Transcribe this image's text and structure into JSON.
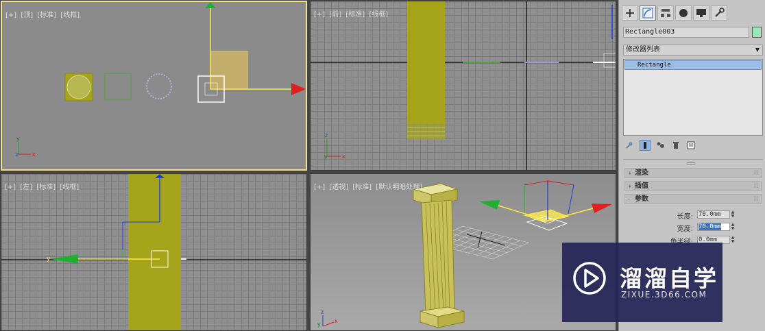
{
  "viewports": {
    "top": {
      "plus": "[+]",
      "view": "[顶]",
      "shading": "[标准]",
      "mode": "[线框]"
    },
    "front": {
      "plus": "[+]",
      "view": "[前]",
      "shading": "[标准]",
      "mode": "[线框]"
    },
    "left": {
      "plus": "[+]",
      "view": "[左]",
      "shading": "[标准]",
      "mode": "[线框]"
    },
    "perspective": {
      "plus": "[+]",
      "view": "[透视]",
      "shading": "[标准]",
      "mode": "[默认明暗处理]"
    }
  },
  "axes": {
    "x": "x",
    "y": "y",
    "z": "z"
  },
  "panel": {
    "tabs": [
      "create-icon",
      "modify-icon",
      "hierarchy-icon",
      "motion-icon",
      "display-icon",
      "utilities-icon"
    ],
    "active_tab": "modify-icon",
    "object_name": "Rectangle003",
    "object_color": "#9ae6b8",
    "modifier_list_label": "修改器列表",
    "modifier_stack": [
      "Rectangle"
    ],
    "rollouts": {
      "render": {
        "sign": "+",
        "label": "渲染"
      },
      "interp": {
        "sign": "+",
        "label": "插值"
      },
      "params": {
        "sign": "-",
        "label": "参数"
      }
    },
    "params": {
      "length": {
        "label": "长度:",
        "value": "70.0mm"
      },
      "width": {
        "label": "宽度:",
        "value": "70.0mm"
      },
      "corner_radius": {
        "label": "角半径:",
        "value": "0.0mm"
      }
    }
  },
  "watermark": {
    "title": "溜溜自学",
    "url": "ZIXUE.3D66.COM"
  },
  "colors": {
    "active_border": "#f3e28a",
    "column": "#a5a41a",
    "gizmo_x": "#e02020",
    "gizmo_y": "#20b030",
    "gizmo_z": "#2040e0",
    "selection": "#9cbde6"
  }
}
